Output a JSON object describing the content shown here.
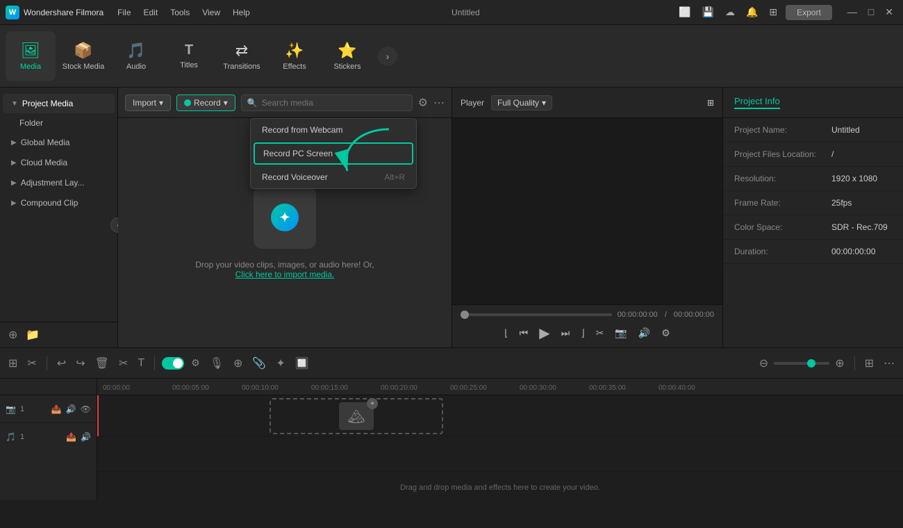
{
  "titlebar": {
    "app_name": "Wondershare Filmora",
    "app_initial": "W",
    "title": "Untitled",
    "menu_items": [
      "File",
      "Edit",
      "Tools",
      "View",
      "Help"
    ],
    "export_label": "Export",
    "window_controls": [
      "—",
      "□",
      "✕"
    ]
  },
  "toolbar": {
    "items": [
      {
        "id": "media",
        "label": "Media",
        "icon": "🖼"
      },
      {
        "id": "stock_media",
        "label": "Stock Media",
        "icon": "📦"
      },
      {
        "id": "audio",
        "label": "Audio",
        "icon": "🎵"
      },
      {
        "id": "titles",
        "label": "Titles",
        "icon": "T"
      },
      {
        "id": "transitions",
        "label": "Transitions",
        "icon": "↔"
      },
      {
        "id": "effects",
        "label": "Effects",
        "icon": "✨"
      },
      {
        "id": "stickers",
        "label": "Stickers",
        "icon": "🌟"
      }
    ],
    "expand_icon": "›"
  },
  "sidebar": {
    "items": [
      {
        "id": "project_media",
        "label": "Project Media",
        "active": true
      },
      {
        "id": "folder",
        "label": "Folder",
        "indent": true
      },
      {
        "id": "global_media",
        "label": "Global Media"
      },
      {
        "id": "cloud_media",
        "label": "Cloud Media"
      },
      {
        "id": "adjustment_layer",
        "label": "Adjustment Lay..."
      },
      {
        "id": "compound_clip",
        "label": "Compound Clip"
      }
    ],
    "bottom_icons": [
      "+",
      "📁"
    ]
  },
  "media_panel": {
    "import_label": "Import",
    "record_label": "Record",
    "search_placeholder": "Search media",
    "dropzone_text": "Drop your video clips, images, or audio here! Or,",
    "dropzone_link": "Click here to import media."
  },
  "record_dropdown": {
    "items": [
      {
        "id": "webcam",
        "label": "Record from Webcam",
        "shortcut": ""
      },
      {
        "id": "screen",
        "label": "Record PC Screen",
        "highlighted": true,
        "shortcut": ""
      },
      {
        "id": "voiceover",
        "label": "Record Voiceover",
        "shortcut": "Alt+R"
      }
    ]
  },
  "player": {
    "label": "Player",
    "quality": "Full Quality",
    "time_current": "00:00:00:00",
    "time_total": "00:00:00:00",
    "separator": "/"
  },
  "project_info": {
    "tab_label": "Project Info",
    "rows": [
      {
        "key": "Project Name:",
        "value": "Untitled"
      },
      {
        "key": "Project Files Location:",
        "value": "/"
      },
      {
        "key": "Resolution:",
        "value": "1920 x 1080"
      },
      {
        "key": "Frame Rate:",
        "value": "25fps"
      },
      {
        "key": "Color Space:",
        "value": "SDR - Rec.709"
      },
      {
        "key": "Duration:",
        "value": "00:00:00:00"
      }
    ]
  },
  "timeline": {
    "toolbar_icons": [
      "⊞",
      "✂",
      "↩",
      "↪",
      "🗑",
      "✂",
      "T",
      "⊕"
    ],
    "right_icons": [
      "⊕",
      "⊖"
    ],
    "ruler_ticks": [
      "00:00:00",
      "00:00:05:00",
      "00:00:10:00",
      "00:00:15:00",
      "00:00:20:00",
      "00:00:25:00",
      "00:00:30:00",
      "00:00:35:00",
      "00:00:40:00"
    ],
    "drop_text": "Drag and drop media and effects here to create your video.",
    "track_icons": [
      "📷1",
      "📤",
      "🔊",
      "👁"
    ],
    "audio_icons": [
      "🎵1",
      "📤",
      "🔊"
    ]
  }
}
